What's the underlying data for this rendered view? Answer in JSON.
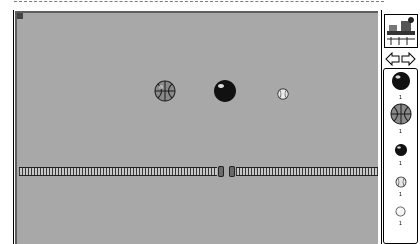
{
  "stage": {
    "background": "#a8a8a8",
    "balls": [
      {
        "kind": "basketball-icon"
      },
      {
        "kind": "bowling-ball-icon"
      },
      {
        "kind": "baseball-icon"
      }
    ]
  },
  "palette": {
    "items": [
      {
        "icon": "bowling-ball-icon",
        "count": "1"
      },
      {
        "icon": "basketball-icon",
        "count": "1"
      },
      {
        "icon": "bowling-ball-small-icon",
        "count": "1"
      },
      {
        "icon": "baseball-icon",
        "count": "1"
      },
      {
        "icon": "ping-pong-ball-icon",
        "count": "1"
      }
    ]
  }
}
